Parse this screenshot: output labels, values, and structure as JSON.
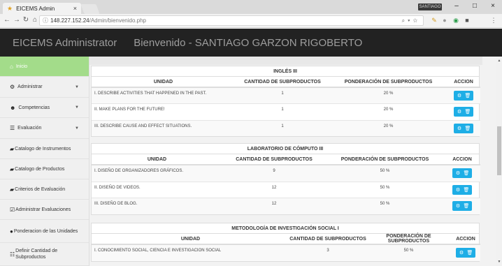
{
  "browser": {
    "tab_title": "EICEMS Admin",
    "tab_close": "×",
    "url_host": "148.227.152.24",
    "url_path": "/Admin/bienvenido.php",
    "account_label": "SANTIAGO",
    "win_min": "–",
    "win_max": "□",
    "win_close": "×"
  },
  "header": {
    "brand": "EICEMS Administrator",
    "welcome": "Bienvenido - SANTIAGO GARZON RIGOBERTO"
  },
  "sidebar": {
    "items": [
      {
        "label": "Inicio",
        "active": true
      },
      {
        "label": "Administrar",
        "caret": true
      },
      {
        "label": "Competencias",
        "caret": true
      },
      {
        "label": "Evaluación",
        "caret": true
      },
      {
        "label": "Catalogo de Instrumentos"
      },
      {
        "label": "Catalogo de Productos"
      },
      {
        "label": "Criterios de Evaluación"
      },
      {
        "label": "Administrar Evaluaciones"
      },
      {
        "label": "Ponderacion de las Unidades"
      },
      {
        "label": "Definir Cantidad de Subproductos"
      }
    ]
  },
  "tables": [
    {
      "title": "INGLÉS III",
      "headers": [
        "UNIDAD",
        "CANTIDAD DE SUBPRODUCTOS",
        "PONDERACIÓN DE SUBPRODUCTOS",
        "ACCION"
      ],
      "rows": [
        [
          "I. DESCRIBE ACTIVITIES THAT HAPPENED IN THE PAST.",
          "1",
          "20 %"
        ],
        [
          "II. MAKE PLANS FOR THE FUTURE!",
          "1",
          "20 %"
        ],
        [
          "III. DESCRIBE CAUSE AND EFFECT SITUATIONS.",
          "1",
          "20 %"
        ]
      ]
    },
    {
      "title": "LABORATORIO DE CÓMPUTO III",
      "headers": [
        "UNIDAD",
        "CANTIDAD DE SUBPRODUCTOS",
        "PONDERACIÓN DE SUBPRODUCTOS",
        "ACCION"
      ],
      "rows": [
        [
          "I. DISEÑO DE ORGANIZADORES GRÁFICOS.",
          "9",
          "50 %"
        ],
        [
          "II. DISEÑO DE VIDEOS.",
          "12",
          "50 %"
        ],
        [
          "III. DISEÑO DE BLOG.",
          "12",
          "50 %"
        ]
      ]
    },
    {
      "title": "METODOLOGÍA DE INVESTIGACIÓN SOCIAL I",
      "headers": [
        "UNIDAD",
        "CANTIDAD DE SUBPRODUCTOS",
        "PONDERACIÓN DE SUBPRODUCTOS",
        "ACCION"
      ],
      "rows": [
        [
          "I. CONOCIMIENTO SOCIAL, CIENCIA E INVESTIGACION SOCIAL",
          "3",
          "50 %"
        ]
      ]
    }
  ],
  "colors": {
    "header_bg": "#222222",
    "sidebar_active": "#a3dc8a",
    "action_button": "#1eaee6"
  },
  "icons": {
    "edit": "gear-icon",
    "delete": "trash-icon"
  }
}
